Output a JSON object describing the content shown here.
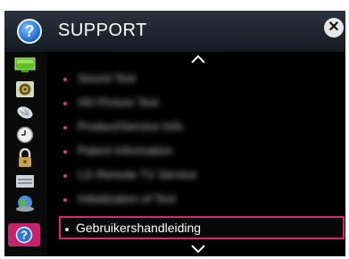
{
  "header": {
    "title": "SUPPORT",
    "help_glyph": "?",
    "close_glyph": "✕"
  },
  "sidebar": {
    "items": [
      {
        "icon": "picture-icon"
      },
      {
        "icon": "speaker-icon"
      },
      {
        "icon": "satellite-dish-icon"
      },
      {
        "icon": "clock-icon"
      },
      {
        "icon": "lock-icon"
      },
      {
        "icon": "options-icon"
      },
      {
        "icon": "network-globe-icon"
      },
      {
        "icon": "support-help-icon",
        "selected": true
      }
    ]
  },
  "menu": {
    "items": [
      {
        "label": "Sound Test",
        "blurred": true
      },
      {
        "label": "HD Picture Test",
        "blurred": true
      },
      {
        "label": "Product/Service Info.",
        "blurred": true
      },
      {
        "label": "Patent Information",
        "blurred": true
      },
      {
        "label": "LG Remote TV Service",
        "blurred": true
      },
      {
        "label": "Initialization of Test",
        "blurred": true
      },
      {
        "label": "Gebruikershandleiding",
        "blurred": false,
        "highlighted": true
      }
    ]
  },
  "colors": {
    "accent": "#d8266f",
    "background": "#000000",
    "text": "#ffffff"
  }
}
